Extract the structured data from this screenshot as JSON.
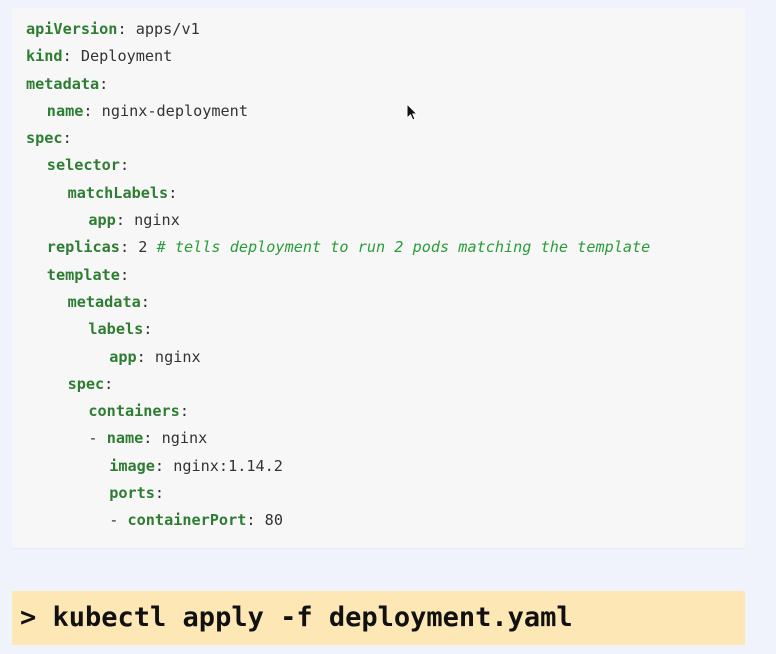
{
  "yaml": {
    "api_version_key": "apiVersion",
    "api_version_value": "apps/v1",
    "kind_key": "kind",
    "kind_value": "Deployment",
    "metadata_key": "metadata",
    "name_key": "name",
    "name_value": "nginx-deployment",
    "spec_key": "spec",
    "selector_key": "selector",
    "match_labels_key": "matchLabels",
    "app_key": "app",
    "app_value": "nginx",
    "replicas_key": "replicas",
    "replicas_value": "2",
    "replicas_comment": "# tells deployment to run 2 pods matching the template",
    "template_key": "template",
    "template_metadata_key": "metadata",
    "labels_key": "labels",
    "template_app_key": "app",
    "template_app_value": "nginx",
    "template_spec_key": "spec",
    "containers_key": "containers",
    "container_dash": "-",
    "container_name_key": "name",
    "container_name_value": "nginx",
    "image_key": "image",
    "image_value": "nginx:1.14.2",
    "ports_key": "ports",
    "port_dash": "-",
    "container_port_key": "containerPort",
    "container_port_value": "80"
  },
  "command": {
    "text": "> kubectl apply -f deployment.yaml"
  },
  "colors": {
    "page_background": "#f0f3fb",
    "code_background": "#f7f7f8",
    "yaml_key": "#2e7d32",
    "yaml_comment": "#2a9d3a",
    "command_background": "#fde7b5"
  },
  "icons": {
    "cursor": "mouse-pointer-icon"
  }
}
